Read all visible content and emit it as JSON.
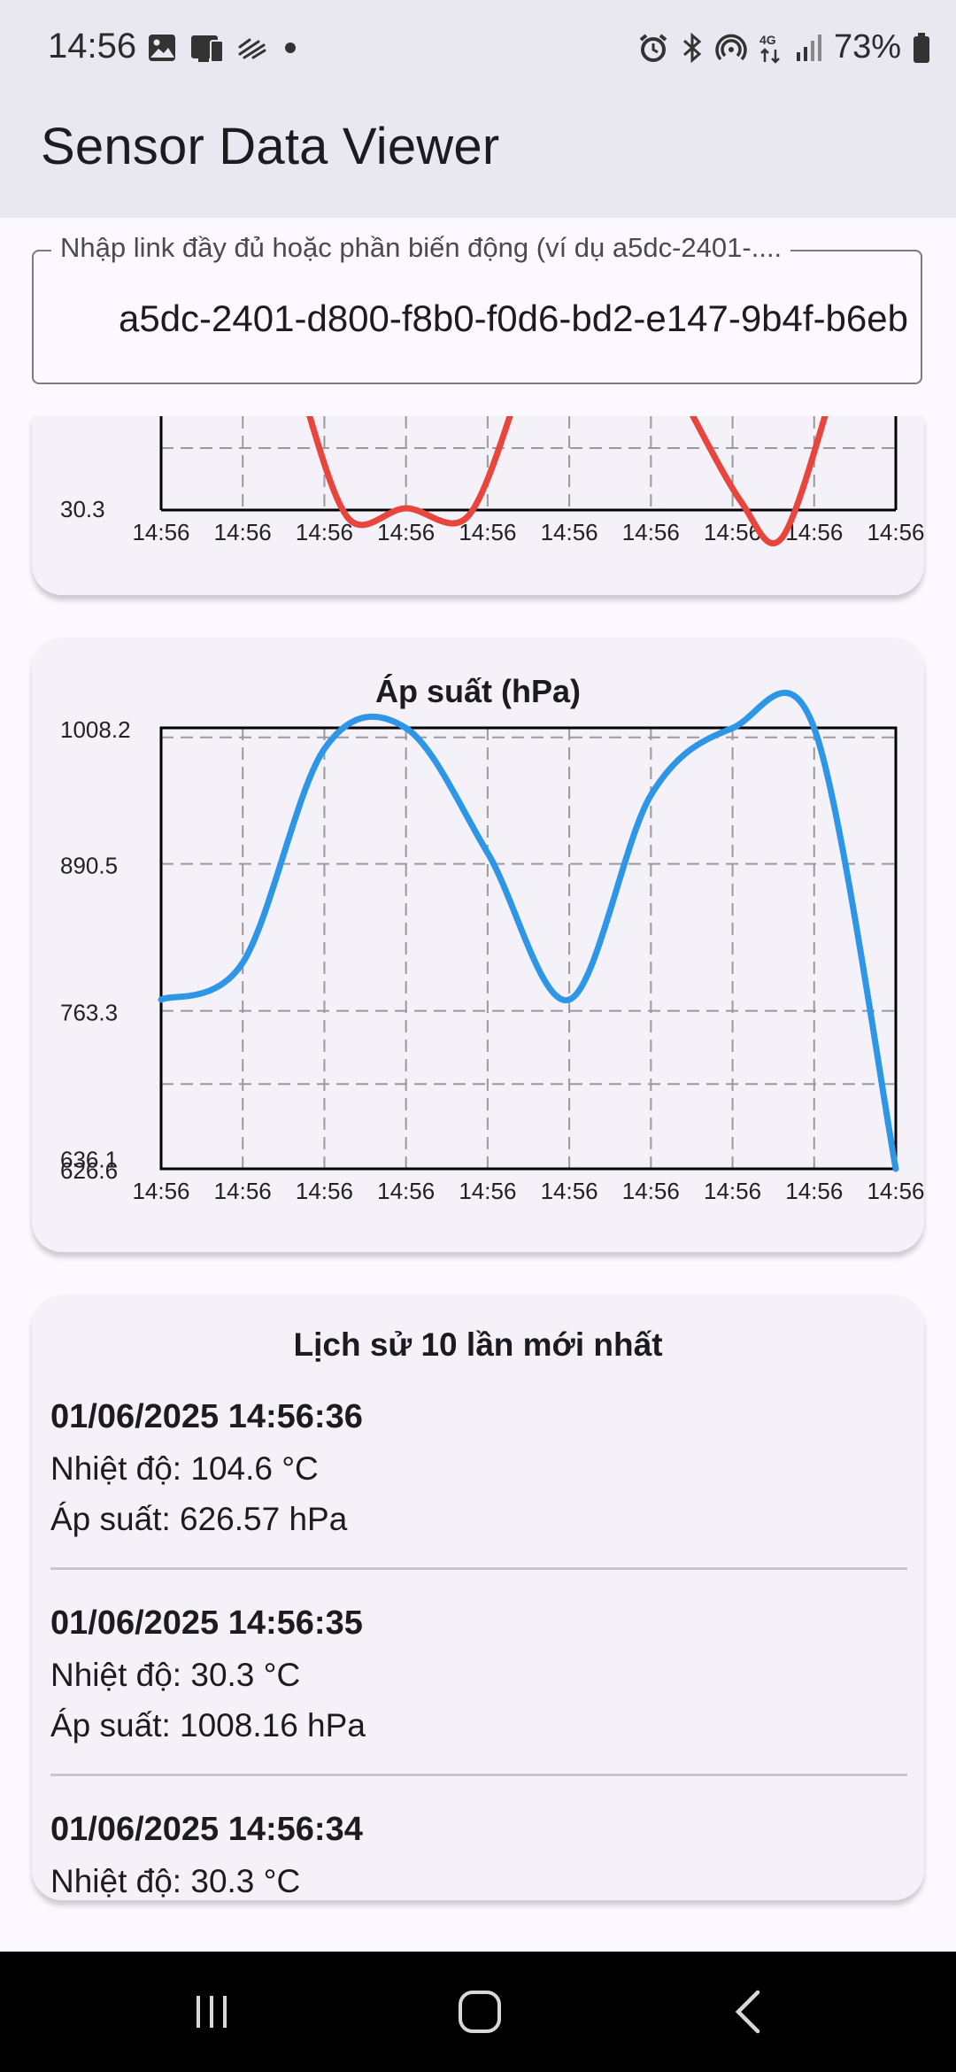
{
  "status_bar": {
    "time": "14:56",
    "battery_percent": "73%",
    "left_icons": [
      "gallery-icon",
      "sim-notification-icon",
      "stripes-icon",
      "dot-icon"
    ],
    "right_icons": [
      "alarm-icon",
      "bluetooth-icon",
      "hotspot-icon",
      "4g-icon",
      "signal-icon",
      "battery-icon"
    ]
  },
  "app_bar": {
    "title": "Sensor Data Viewer"
  },
  "link_input": {
    "label": "Nhập link đầy đủ hoặc phần biến động (ví dụ a5dc-2401-....",
    "value": "a5dc-2401-d800-f8b0-f0d6-bd2-e147-9b4f-b6eb"
  },
  "temperature_chart": {
    "y_tick_visible": "30.3",
    "x_ticks": [
      "14:56",
      "14:56",
      "14:56",
      "14:56",
      "14:56",
      "14:56",
      "14:56",
      "14:56",
      "14:56",
      "14:56"
    ],
    "line_color": "#e8453c"
  },
  "pressure_chart": {
    "title": "Áp suất (hPa)",
    "line_color": "#2e96e6"
  },
  "chart_data": [
    {
      "type": "line",
      "title": "",
      "xlabel": "",
      "ylabel": "",
      "categories": [
        "14:56",
        "14:56",
        "14:56",
        "14:56",
        "14:56",
        "14:56",
        "14:56",
        "14:56",
        "14:56",
        "14:56"
      ],
      "yticks": [
        "30.3"
      ],
      "series": [
        {
          "name": "",
          "values": [
            null,
            31.5,
            30.4,
            30.6,
            30.4,
            null,
            null,
            31.0,
            30.3,
            null
          ]
        }
      ],
      "note_visible": "only lower portion of chart visible (scrolled)"
    },
    {
      "type": "line",
      "title": "Áp suất (hPa)",
      "xlabel": "",
      "ylabel": "",
      "categories": [
        "14:56",
        "14:56",
        "14:56",
        "14:56",
        "14:56",
        "14:56",
        "14:56",
        "14:56",
        "14:56",
        "14:56"
      ],
      "yticks": [
        "1008.2",
        "890.5",
        "763.3",
        "636.1",
        "626.6"
      ],
      "ylim": [
        626.6,
        1008.2
      ],
      "series": [
        {
          "name": "",
          "values": [
            773,
            805,
            990,
            1008,
            900,
            773,
            950,
            1008,
            1008,
            626.6
          ]
        }
      ]
    }
  ],
  "history": {
    "title": "Lịch sử 10 lần mới nhất",
    "items": [
      {
        "time": "01/06/2025 14:56:36",
        "temp": "Nhiệt độ: 104.6 °C",
        "pressure": "Áp suất: 626.57 hPa"
      },
      {
        "time": "01/06/2025 14:56:35",
        "temp": "Nhiệt độ: 30.3 °C",
        "pressure": "Áp suất: 1008.16 hPa"
      },
      {
        "time": "01/06/2025 14:56:34",
        "temp": "Nhiệt độ: 30.3 °C",
        "pressure": ""
      }
    ]
  },
  "nav_bar": {
    "icons": [
      "recent-apps-icon",
      "home-icon",
      "back-icon"
    ]
  }
}
